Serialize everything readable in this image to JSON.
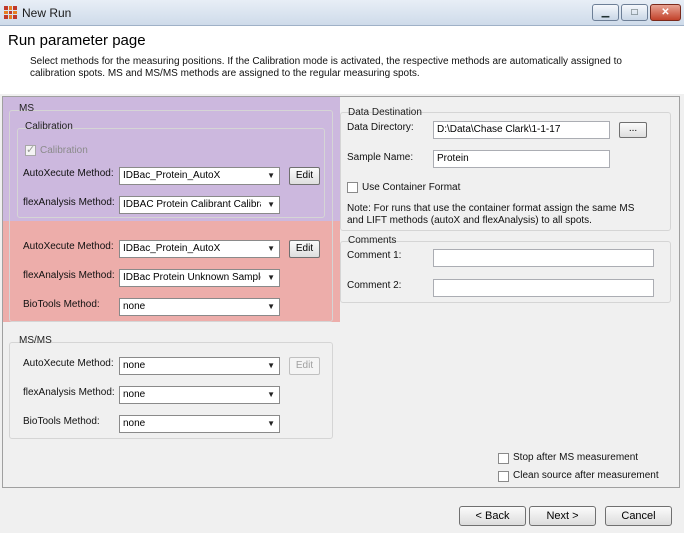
{
  "window": {
    "title": "New Run",
    "min_glyph": "▁",
    "max_glyph": "□",
    "close_glyph": "✕"
  },
  "header": {
    "title": "Run parameter page",
    "description": "Select methods for the measuring positions. If the Calibration mode is activated, the respective methods are automatically assigned to calibration spots. MS and MS/MS methods are assigned to the regular measuring spots."
  },
  "ms": {
    "group_label": "MS",
    "calibration": {
      "group_label": "Calibration",
      "checkbox_label": "Calibration",
      "checked": true,
      "autoxecute_label": "AutoXecute Method:",
      "autoxecute_value": "IDBac_Protein_AutoX",
      "edit_label": "Edit",
      "flexanalysis_label": "flexAnalysis Method:",
      "flexanalysis_value": "IDBAC Protein Calibrant Calibrati"
    },
    "autoxecute_label": "AutoXecute Method:",
    "autoxecute_value": "IDBac_Protein_AutoX",
    "edit_label": "Edit",
    "flexanalysis_label": "flexAnalysis Method:",
    "flexanalysis_value": "IDBac Protein Unknown Sample",
    "biotools_label": "BioTools Method:",
    "biotools_value": "none"
  },
  "msms": {
    "group_label": "MS/MS",
    "autoxecute_label": "AutoXecute Method:",
    "autoxecute_value": "none",
    "edit_label": "Edit",
    "flexanalysis_label": "flexAnalysis Method:",
    "flexanalysis_value": "none",
    "biotools_label": "BioTools Method:",
    "biotools_value": "none"
  },
  "data_destination": {
    "group_label": "Data Destination",
    "directory_label": "Data Directory:",
    "directory_value": "D:\\Data\\Chase Clark\\1-1-17",
    "browse_label": "...",
    "sample_label": "Sample Name:",
    "sample_value": "Protein",
    "container_label": "Use Container Format",
    "container_checked": false,
    "note": "Note: For runs that use the container format assign the same MS and LIFT methods (autoX and flexAnalysis) to all spots."
  },
  "comments": {
    "group_label": "Comments",
    "comment1_label": "Comment 1:",
    "comment1_value": "",
    "comment2_label": "Comment 2:",
    "comment2_value": ""
  },
  "options": {
    "stop_after_ms": "Stop after MS measurement",
    "stop_after_ms_checked": false,
    "clean_source": "Clean source after measurement",
    "clean_source_checked": false
  },
  "footer": {
    "back_label": "< Back",
    "next_label": "Next >",
    "cancel_label": "Cancel"
  },
  "colors": {
    "highlight_purple": "#b796d3",
    "highlight_red": "#ec847f"
  }
}
